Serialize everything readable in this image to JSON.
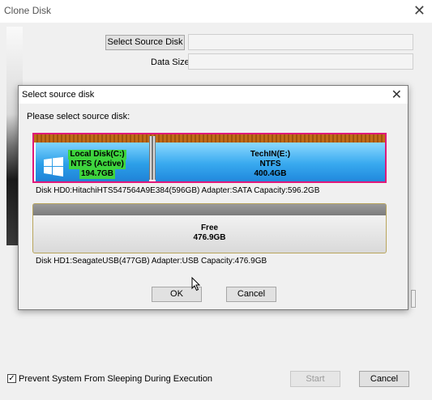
{
  "window": {
    "title": "Clone Disk",
    "close_glyph": "✕"
  },
  "main": {
    "select_source_button": "Select Source Disk",
    "data_size_label": "Data Size:",
    "source_value": "",
    "data_size_value": ""
  },
  "dialog": {
    "title": "Select source disk",
    "close_glyph": "✕",
    "prompt": "Please select source disk:",
    "ok_label": "OK",
    "cancel_label": "Cancel"
  },
  "disk0": {
    "selected": true,
    "partitions": [
      {
        "name": "Local Disk(C:)",
        "fs": "NTFS (Active)",
        "size": "194.7GB",
        "icon": "windows-logo-icon"
      },
      {
        "name": "TechIN(E:)",
        "fs": "NTFS",
        "size": "400.4GB"
      }
    ],
    "info": "Disk HD0:HitachiHTS547564A9E384(596GB)  Adapter:SATA  Capacity:596.2GB"
  },
  "disk1": {
    "partitions": [
      {
        "name": "Free",
        "size": "476.9GB"
      }
    ],
    "info": "Disk HD1:SeagateUSB(477GB)  Adapter:USB  Capacity:476.9GB"
  },
  "footer": {
    "prevent_sleep_label": "Prevent System From Sleeping During Execution",
    "prevent_sleep_checked": true,
    "check_glyph": "✓",
    "start_label": "Start",
    "cancel_label": "Cancel"
  },
  "colors": {
    "selected_border": "#e0197a",
    "partition_blue": "#2c9fe8",
    "highlight_green": "#3ed43e"
  }
}
